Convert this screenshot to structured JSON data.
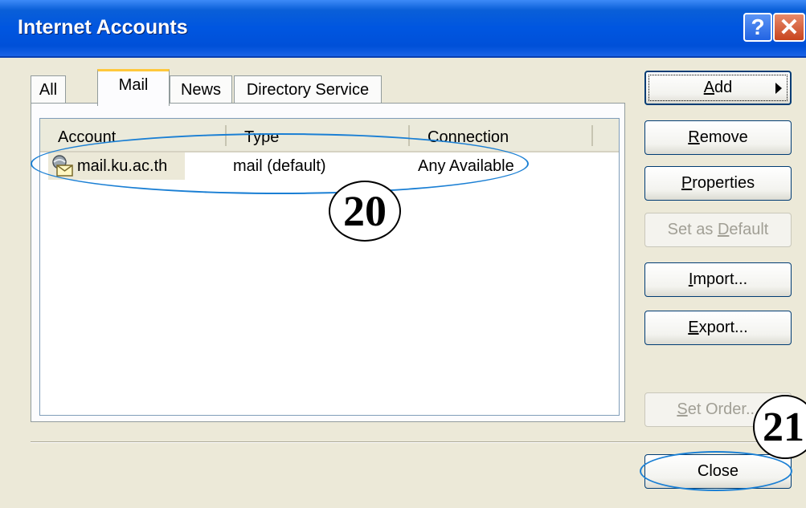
{
  "window": {
    "title": "Internet Accounts",
    "help_label": "?",
    "close_label": "✕"
  },
  "tabs": [
    {
      "label": "All"
    },
    {
      "label": "Mail"
    },
    {
      "label": "News"
    },
    {
      "label": "Directory Service"
    }
  ],
  "active_tab": "Mail",
  "list": {
    "columns": [
      "Account",
      "Type",
      "Connection"
    ],
    "rows": [
      {
        "icon": "mail-account-icon",
        "account": "mail.ku.ac.th",
        "type": "mail (default)",
        "connection": "Any Available"
      }
    ]
  },
  "buttons": {
    "add": {
      "pre": "",
      "key": "A",
      "post": "dd"
    },
    "remove": {
      "pre": "",
      "key": "R",
      "post": "emove"
    },
    "properties": {
      "pre": "",
      "key": "P",
      "post": "roperties"
    },
    "set_default": {
      "pre": "Set as ",
      "key": "D",
      "post": "efault"
    },
    "import": {
      "pre": "",
      "key": "I",
      "post": "mport..."
    },
    "export": {
      "pre": "",
      "key": "E",
      "post": "xport..."
    },
    "set_order": {
      "pre": "",
      "key": "S",
      "post": "et Order..."
    },
    "close": {
      "label": "Close"
    }
  },
  "annotations": {
    "callout_1": "20",
    "callout_2": "21"
  },
  "colors": {
    "titlebar": "#0054e3",
    "active_tab_accent": "#ffc83c",
    "annotation_outline": "#1a7fd4"
  }
}
